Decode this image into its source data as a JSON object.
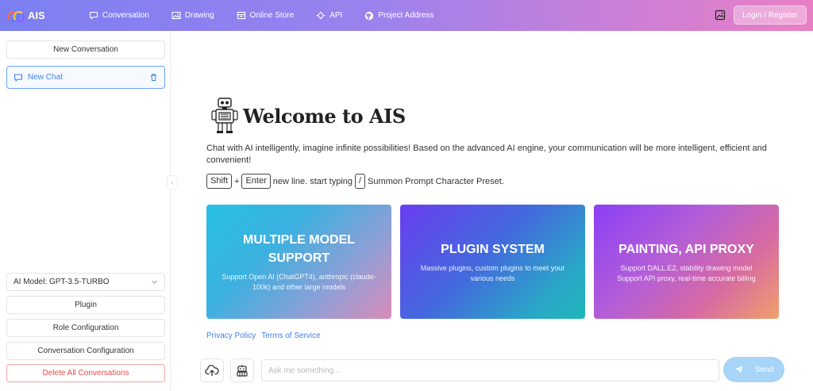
{
  "app": {
    "name": "AIS"
  },
  "nav": {
    "items": [
      {
        "label": "Conversation",
        "icon": "chat-bubble-icon"
      },
      {
        "label": "Drawing",
        "icon": "image-icon"
      },
      {
        "label": "Online Store",
        "icon": "store-icon"
      },
      {
        "label": "API",
        "icon": "api-icon"
      },
      {
        "label": "Project Address",
        "icon": "github-icon"
      }
    ],
    "login_label": "Login / Register"
  },
  "sidebar": {
    "new_conversation": "New Conversation",
    "chats": [
      {
        "label": "New Chat",
        "active": true
      }
    ],
    "model_select": "AI Model: GPT-3.5-TURBO",
    "plugin": "Plugin",
    "role_config": "Role Configuration",
    "conversation_config": "Conversation Configuration",
    "delete_all": "Delete All Conversations"
  },
  "main": {
    "welcome_title": "Welcome to AIS",
    "description": "Chat with AI intelligently, imagine infinite possibilities! Based on the advanced AI engine, your communication will be more intelligent, efficient and convenient!",
    "hint": {
      "key1": "Shift",
      "plus": "+",
      "key2": "Enter",
      "text1": "new line. start typing",
      "key3": "/",
      "text2": "Summon Prompt Character Preset."
    },
    "cards": [
      {
        "title": "MULTIPLE MODEL SUPPORT",
        "desc": "Support Open AI (ChatGPT4), anthropic (claude-100k) and other large models"
      },
      {
        "title": "PLUGIN SYSTEM",
        "desc": "Massive plugins, custom plugins to meet your various needs"
      },
      {
        "title": "PAINTING, API PROXY",
        "desc": "Support DALL.E2, stability drawing model Support API proxy, real-time accurate billing"
      }
    ],
    "links": {
      "privacy": "Privacy Policy",
      "terms": "Terms of Service"
    },
    "input": {
      "placeholder": "Ask me something...",
      "send_label": "Send"
    }
  },
  "colors": {
    "accent": "#3e7fe6",
    "danger": "#f04a4a",
    "send_button": "#a7d4f7"
  }
}
